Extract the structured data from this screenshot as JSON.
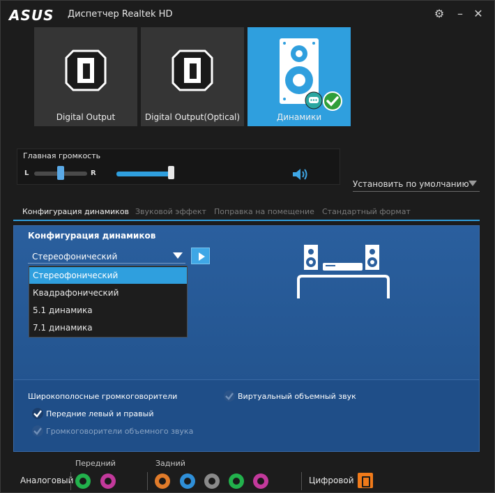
{
  "titlebar": {
    "logo": "ASUS",
    "title": "Диспетчер Realtek HD",
    "settings_icon": "gear-icon",
    "minimize_icon": "minimize-icon",
    "close_icon": "close-icon"
  },
  "devices": [
    {
      "label": "Digital Output",
      "icon": "digital-output-icon",
      "active": false
    },
    {
      "label": "Digital Output(Optical)",
      "icon": "digital-optical-icon",
      "active": false
    },
    {
      "label": "Динамики",
      "icon": "speakers-icon",
      "active": true
    }
  ],
  "volume": {
    "title": "Главная громкость",
    "left_label": "L",
    "right_label": "R",
    "balance_fraction": 0.5,
    "level_fraction": 1.0,
    "mute_icon": "speaker-icon"
  },
  "default_button": {
    "label": "Установить по умолчанию"
  },
  "tabs": [
    {
      "label": "Конфигурация динамиков",
      "active": true
    },
    {
      "label": "Звуковой эффект",
      "active": false
    },
    {
      "label": "Поправка на помещение",
      "active": false
    },
    {
      "label": "Стандартный формат",
      "active": false
    }
  ],
  "config": {
    "title": "Конфигурация динамиков",
    "selected": "Стереофонический",
    "options": [
      "Стереофонический",
      "Квадрафонический",
      "5.1 динамика",
      "7.1 динамика"
    ]
  },
  "options": {
    "wideband": "Широкополосные громкоговорители",
    "front_lr": "Передние левый и правый",
    "surround": "Громкоговорители объемного звука",
    "virtual_surround": "Виртуальный объемный звук"
  },
  "jacks": {
    "analog_label": "Аналоговый",
    "front_label": "Передний",
    "rear_label": "Задний",
    "digital_label": "Цифровой",
    "front_colors": [
      "#22b14c",
      "#c2399b"
    ],
    "rear_colors": [
      "#e07b2a",
      "#2f8fd8",
      "#8a8a8a",
      "#22b14c",
      "#c2399b"
    ]
  },
  "accent_color": "#2f9fde"
}
